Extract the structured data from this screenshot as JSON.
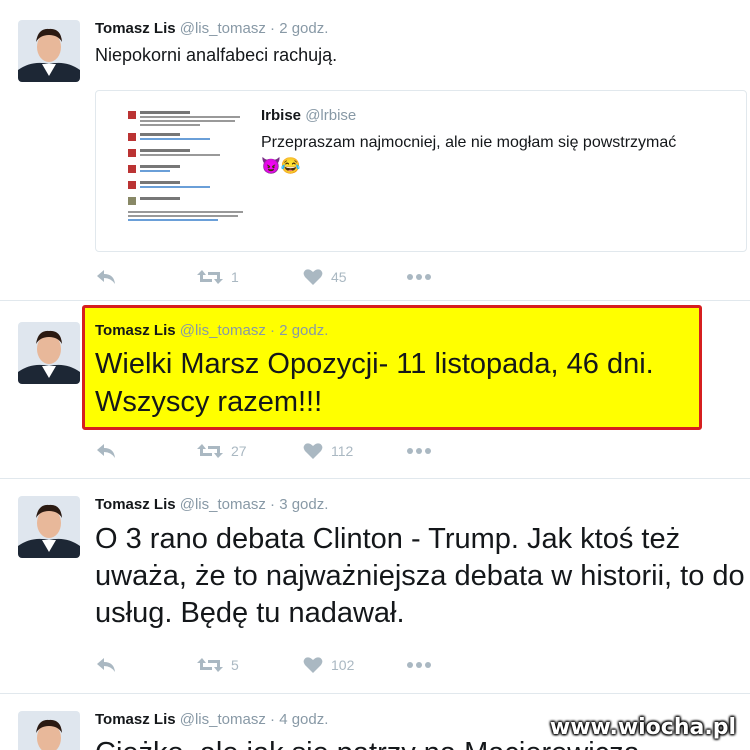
{
  "colors": {
    "name": "#14171a",
    "meta": "#8899a6",
    "action_icon": "#aab8c2",
    "highlight_bg": "#ffff00",
    "highlight_border": "#d61f1f",
    "divider": "#e1e8ed"
  },
  "tweets": [
    {
      "name": "Tomasz Lis",
      "handle": "@lis_tomasz",
      "separator": "·",
      "time": "2 godz.",
      "text": "Niepokorni analfabeci rachują.",
      "quote": {
        "name": "Irbise",
        "handle": "@lrbise",
        "text": "Przepraszam najmocniej, ale nie mogłam się powstrzymać 😈😂"
      },
      "retweets": "1",
      "likes": "45"
    },
    {
      "name": "Tomasz Lis",
      "handle": "@lis_tomasz",
      "separator": "·",
      "time": "2 godz.",
      "text": "Wielki Marsz Opozycji- 11 listopada, 46 dni. Wszyscy razem!!!",
      "retweets": "27",
      "likes": "112"
    },
    {
      "name": "Tomasz Lis",
      "handle": "@lis_tomasz",
      "separator": "·",
      "time": "3 godz.",
      "text": "O 3 rano debata Clinton - Trump. Jak ktoś też uważa, że to najważniejsza debata w historii, to do usług. Będę tu nadawał.",
      "retweets": "5",
      "likes": "102"
    },
    {
      "name": "Tomasz Lis",
      "handle": "@lis_tomasz",
      "separator": "·",
      "time": "4 godz.",
      "text": "Ciężko, ale jak się patrzy na Macierewicza"
    }
  ],
  "icons": [
    "reply-icon",
    "retweet-icon",
    "like-icon",
    "more-icon"
  ],
  "watermark": "www.wiocha.pl"
}
